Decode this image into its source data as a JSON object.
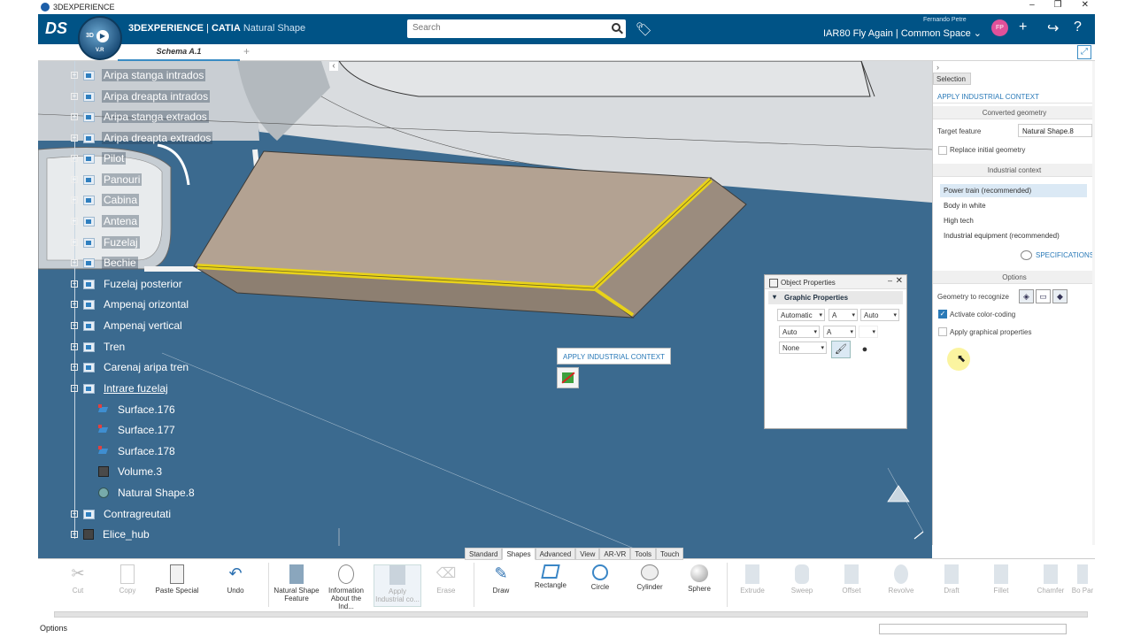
{
  "window": {
    "title": "3DEXPERIENCE",
    "controls": [
      "–",
      "❐",
      "✕"
    ]
  },
  "header": {
    "brand_bold": "3DEXPERIENCE",
    "brand_sep": " | ",
    "brand_catia": "CATIA",
    "app_name": "Natural Shape",
    "compass_3d": "3D",
    "compass_vr": "V.R",
    "search_placeholder": "Search",
    "user_name": "Fernando Petre",
    "user_initials": "FP",
    "space_title": "IAR80 Fly Again | Common Space ⌄"
  },
  "tabs": {
    "active": "Schema A.1",
    "add": "+"
  },
  "tree": {
    "collapse": "‹",
    "items": [
      {
        "label": "Aripa stanga intrados"
      },
      {
        "label": "Aripa dreapta intrados"
      },
      {
        "label": "Aripa stanga extrados"
      },
      {
        "label": "Aripa dreapta extrados"
      },
      {
        "label": "Pilot"
      },
      {
        "label": "Panouri"
      },
      {
        "label": "Cabina"
      },
      {
        "label": "Antena"
      },
      {
        "label": "Fuzelaj"
      },
      {
        "label": "Bechie"
      },
      {
        "label": "Fuzelaj posterior"
      },
      {
        "label": "Ampenaj orizontal"
      },
      {
        "label": "Ampenaj vertical"
      },
      {
        "label": "Tren"
      },
      {
        "label": "Carenaj aripa tren"
      },
      {
        "label": "Intrare fuzelaj"
      },
      {
        "label": "Surface.176"
      },
      {
        "label": "Surface.177"
      },
      {
        "label": "Surface.178"
      },
      {
        "label": "Volume.3"
      },
      {
        "label": "Natural Shape.8"
      },
      {
        "label": "Contragreutati"
      },
      {
        "label": "Elice_hub"
      }
    ]
  },
  "context_tooltip": "APPLY INDUSTRIAL CONTEXT",
  "object_properties": {
    "title": "Object Properties",
    "section": "Graphic Properties",
    "row1": [
      "Automatic",
      "A",
      "Auto"
    ],
    "row2": [
      "Auto",
      "A",
      ""
    ],
    "row3": [
      "None"
    ],
    "min": "–",
    "close": "✕"
  },
  "right_panel": {
    "collapse": "›",
    "selection_tab": "Selection",
    "command_title": "APPLY INDUSTRIAL CONTEXT",
    "converted_geometry": "Converted geometry",
    "target_feature_label": "Target feature",
    "target_feature_value": "Natural Shape.8",
    "replace_label": "Replace initial geometry",
    "industrial_context": "Industrial context",
    "contexts": [
      "Power train (recommended)",
      "Body in white",
      "High tech",
      "Industrial equipment (recommended)"
    ],
    "specifications": "SPECIFICATIONS",
    "options": "Options",
    "geometry_label": "Geometry to recognize",
    "activate_color": "Activate color-coding",
    "apply_graphical": "Apply graphical properties",
    "check": "✓"
  },
  "section_tabs": [
    "Standard",
    "Shapes",
    "Advanced",
    "View",
    "AR-VR",
    "Tools",
    "Touch"
  ],
  "tools": [
    {
      "label": "Cut",
      "icon": "cut-icon"
    },
    {
      "label": "Copy",
      "icon": "copy-icon"
    },
    {
      "label": "Paste Special",
      "icon": "paste-icon"
    },
    {
      "label": "Undo",
      "icon": "undo-icon"
    },
    {
      "label": "Natural Shape Feature",
      "icon": "natural-shape-icon"
    },
    {
      "label": "Information About the Ind...",
      "icon": "info-icon"
    },
    {
      "label": "Apply Industrial co...",
      "icon": "apply-context-icon"
    },
    {
      "label": "Erase",
      "icon": "erase-icon"
    },
    {
      "label": "Draw",
      "icon": "draw-icon"
    },
    {
      "label": "Rectangle",
      "icon": "rectangle-icon"
    },
    {
      "label": "Circle",
      "icon": "circle-icon"
    },
    {
      "label": "Cylinder",
      "icon": "cylinder-icon"
    },
    {
      "label": "Sphere",
      "icon": "sphere-icon"
    },
    {
      "label": "Extrude",
      "icon": "extrude-icon"
    },
    {
      "label": "Sweep",
      "icon": "sweep-icon"
    },
    {
      "label": "Offset",
      "icon": "offset-icon"
    },
    {
      "label": "Revolve",
      "icon": "revolve-icon"
    },
    {
      "label": "Draft",
      "icon": "draft-icon"
    },
    {
      "label": "Fillet",
      "icon": "fillet-icon"
    },
    {
      "label": "Chamfer",
      "icon": "chamfer-icon"
    },
    {
      "label": "Bo Par",
      "icon": "boolean-icon"
    }
  ],
  "status": {
    "text": "Options"
  },
  "colors": {
    "header": "#005386",
    "viewport": "#3b6a8f",
    "accent": "#2a7ab8",
    "highlight": "#e8d21a"
  }
}
